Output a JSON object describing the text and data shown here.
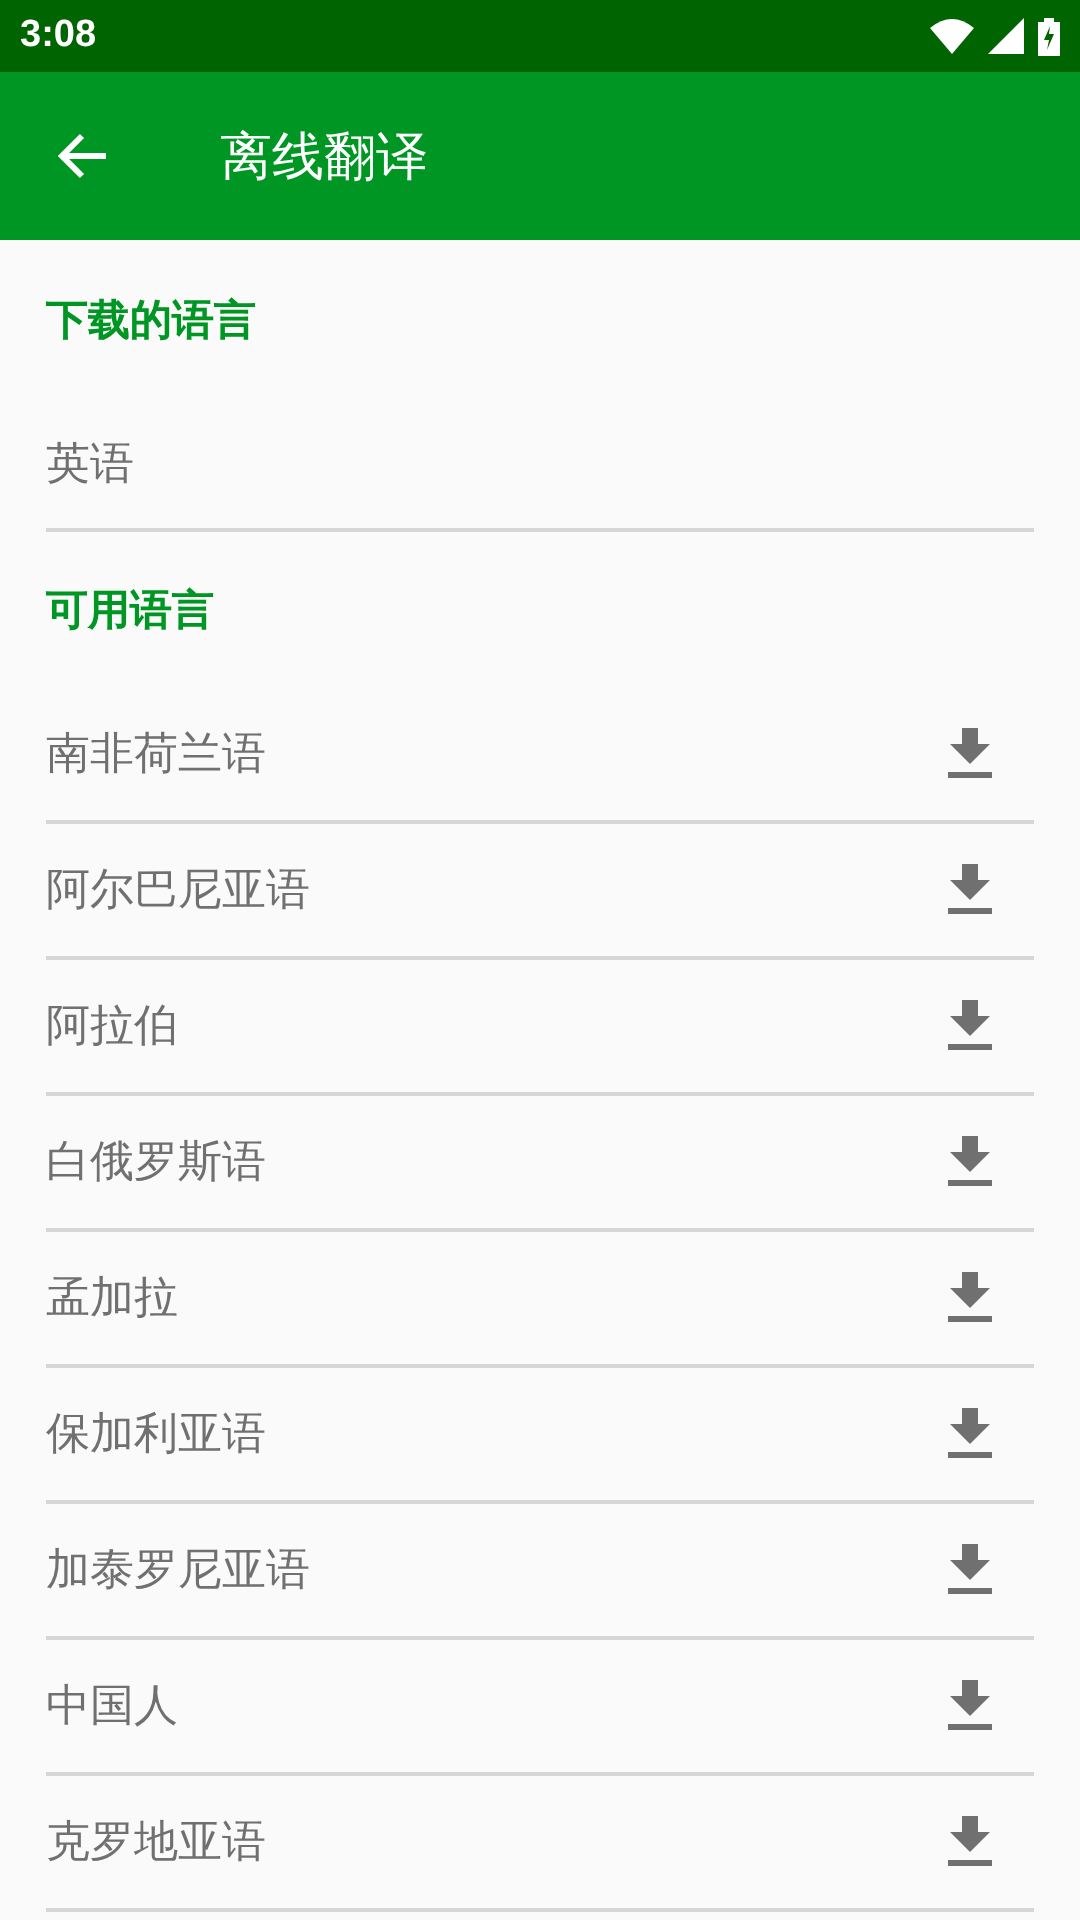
{
  "status_bar": {
    "time": "3:08"
  },
  "toolbar": {
    "title": "离线翻译"
  },
  "sections": [
    {
      "title": "下载的语言",
      "kind": "downloaded",
      "items": [
        "英语"
      ]
    },
    {
      "title": "可用语言",
      "kind": "available",
      "items": [
        "南非荷兰语",
        "阿尔巴尼亚语",
        "阿拉伯",
        "白俄罗斯语",
        "孟加拉",
        "保加利亚语",
        "加泰罗尼亚语",
        "中国人",
        "克罗地亚语"
      ]
    }
  ]
}
